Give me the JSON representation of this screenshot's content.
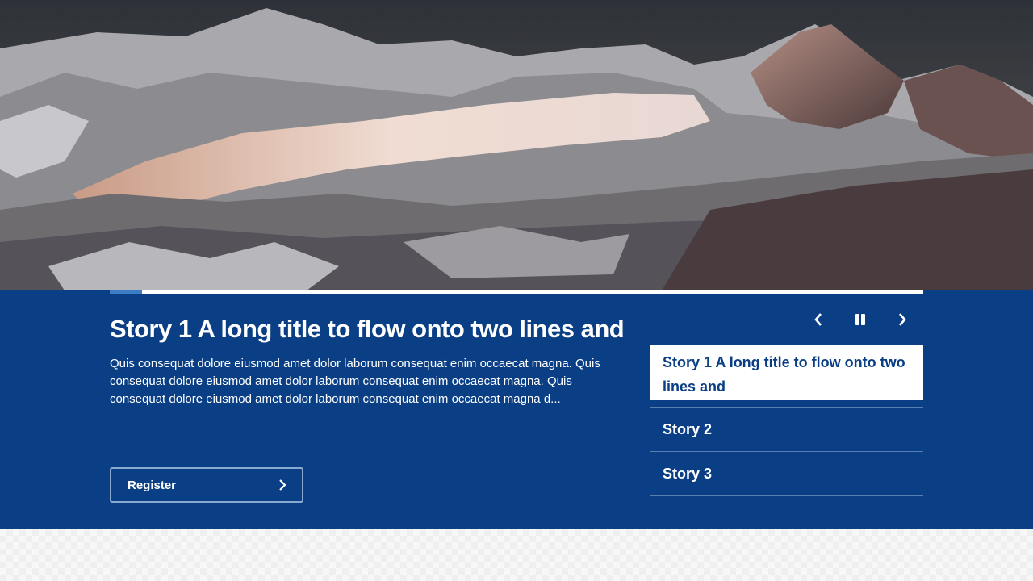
{
  "carousel": {
    "progress_fraction": 0.04,
    "active_story": {
      "title": "Story 1 A long title to flow onto two lines and",
      "description": "Quis consequat dolore eiusmod amet dolor laborum consequat enim occaecat magna. Quis consequat dolore eiusmod amet dolor laborum consequat enim occaecat magna. Quis consequat dolore eiusmod amet dolor laborum consequat enim occaecat magna d...",
      "cta_label": "Register"
    },
    "controls": {
      "previous_icon": "chevron-left-icon",
      "pause_icon": "pause-icon",
      "next_icon": "chevron-right-icon"
    },
    "stories": [
      {
        "label": "Story 1 A long title to flow onto two lines and",
        "active": true
      },
      {
        "label": "Story 2",
        "active": false
      },
      {
        "label": "Story 3",
        "active": false
      }
    ]
  },
  "colors": {
    "panel_background": "#0b3f85",
    "progress_fill": "#3d7cc4",
    "active_story_background": "#ffffff",
    "text_on_panel": "#ffffff"
  }
}
